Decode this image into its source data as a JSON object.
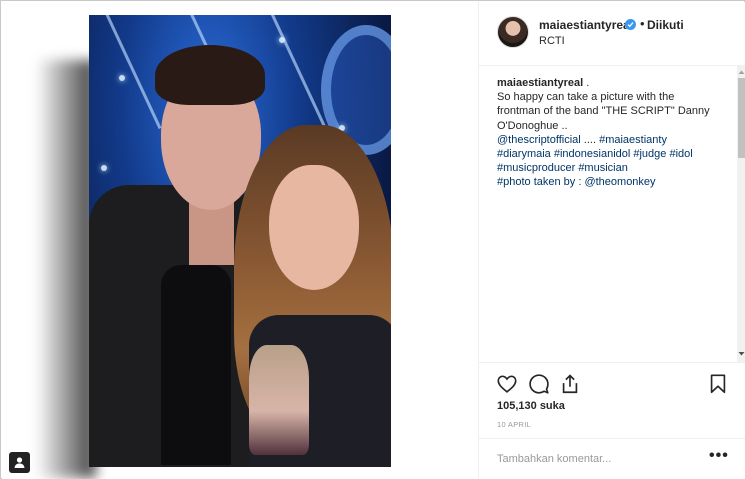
{
  "post": {
    "username": "maiaestiantyreal",
    "follow_separator": "•",
    "follow_label": "Diikuti",
    "location": "RCTI"
  },
  "caption": {
    "username": "maiaestiantyreal",
    "lines": [
      " .",
      "So happy can take a picture with the",
      "frontman of the band \"THE SCRIPT\" Danny",
      "O'Donoghue ..",
      "@thescriptofficial .... #maiaestianty",
      "#diarymaia #indonesianidol #judge #idol",
      "#musicproducer #musician",
      "#photo taken by : @theomonkey"
    ],
    "line5_mention": "@thescriptofficial",
    "line5_sep": " .... ",
    "line5_tag": "#maiaestianty",
    "line6": "#diarymaia #indonesianidol #judge #idol",
    "line7": "#musicproducer #musician",
    "line8_prefix": "#photo taken by : ",
    "line8_mention": "@theomonkey"
  },
  "stats": {
    "likes": "105,130 suka",
    "date": "10 APRIL"
  },
  "comment": {
    "placeholder": "Tambahkan komentar...",
    "more_label": "•••"
  },
  "icons": {
    "like": "heart-icon",
    "comment": "comment-icon",
    "share": "share-icon",
    "save": "bookmark-icon",
    "verified": "verified-badge-icon",
    "tag": "user-tag-icon"
  },
  "colors": {
    "link": "#003569",
    "verified": "#3897f0",
    "muted": "#999999",
    "text": "#262626"
  }
}
